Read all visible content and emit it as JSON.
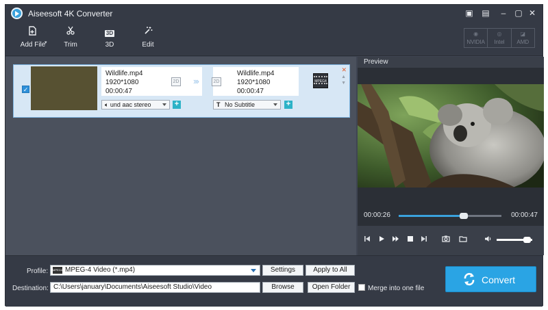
{
  "window": {
    "title": "Aiseesoft 4K Converter",
    "controls": [
      "▣",
      "▤",
      "–",
      "▢",
      "✕"
    ]
  },
  "toolbar": {
    "add_file": "Add File",
    "trim": "Trim",
    "threed": "3D",
    "edit": "Edit",
    "threed_icon_text": "3D",
    "hw_accel": [
      {
        "label": "NVIDIA",
        "icon": "nvidia-logo"
      },
      {
        "label": "Intel",
        "icon": "intel-logo"
      },
      {
        "label": "AMD",
        "icon": "amd-logo"
      }
    ]
  },
  "file": {
    "thumb_text": "",
    "source": {
      "name": "Wildlife.mp4",
      "resolution": "1920*1080",
      "duration": "00:00:47",
      "mode": "2D"
    },
    "output": {
      "name": "Wildlife.mp4",
      "resolution": "1920*1080",
      "duration": "00:00:47",
      "mode": "2D"
    },
    "arrows": "›››",
    "audio": "und aac stereo",
    "subtitle": "No Subtitle",
    "subtitle_icon": "T",
    "format_badge": "MPEG4",
    "checked": true
  },
  "preview": {
    "header": "Preview",
    "time_current": "00:00:26",
    "time_total": "00:00:47",
    "progress": 0.63,
    "volume": 0.85
  },
  "bottom": {
    "profile_label": "Profile:",
    "profile_value": "MPEG-4 Video (*.mp4)",
    "profile_icon_text": "MPEG4",
    "settings": "Settings",
    "apply_all": "Apply to All",
    "destination_label": "Destination:",
    "destination_value": "C:\\Users\\january\\Documents\\Aiseesoft Studio\\Video",
    "browse": "Browse",
    "open_folder": "Open Folder",
    "merge_label": "Merge into one file",
    "convert": "Convert"
  },
  "colors": {
    "accent": "#2aa4e4",
    "window_bg": "#3f4552",
    "file_row_bg": "#d7e7f5"
  }
}
